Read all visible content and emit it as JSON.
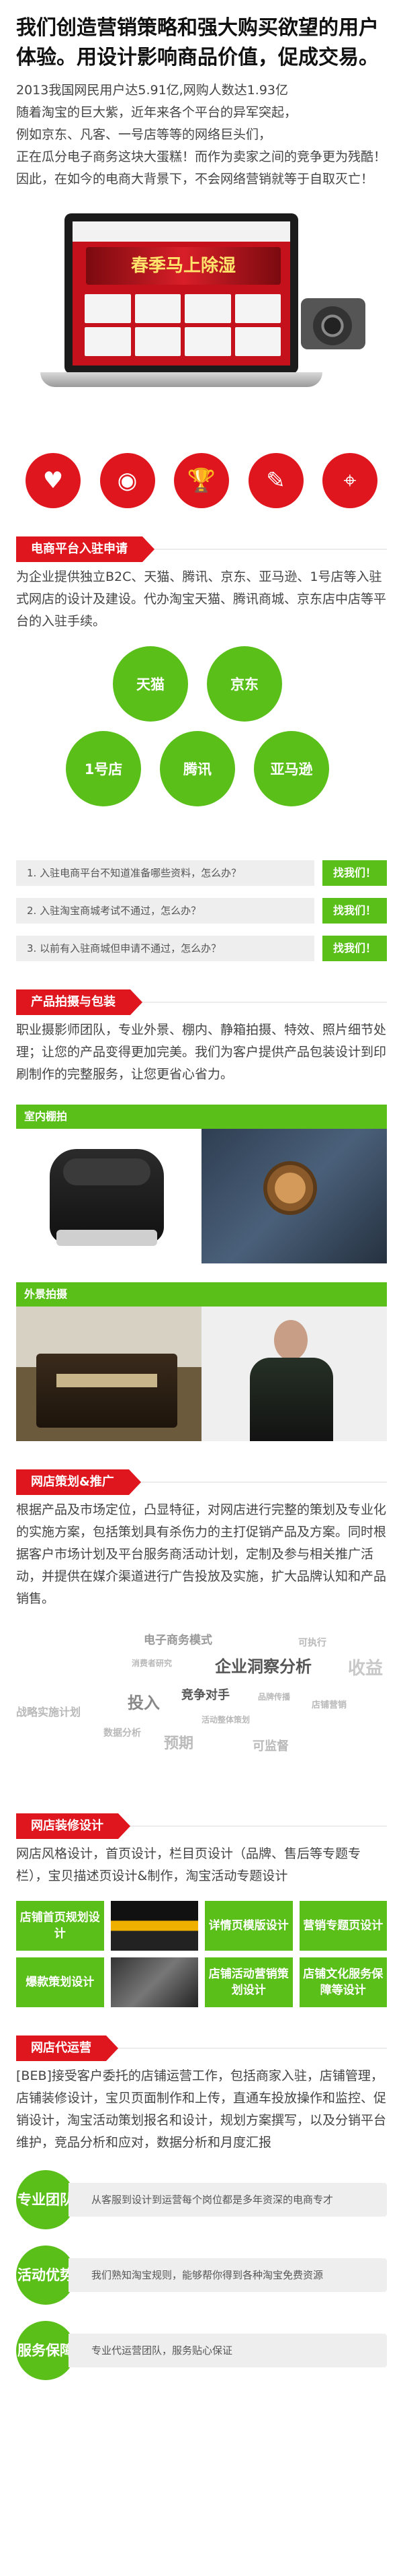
{
  "headline": "我们创造营销策略和强大购买欲望的用户体验。用设计影响商品价值，促成交易。",
  "intro": [
    "2013我国网民用户达5.91亿,网购人数达1.93亿",
    "随着淘宝的巨大紫，近年来各个平台的异军突起，",
    "例如京东、凡客、一号店等等的网络巨头们，",
    "正在瓜分电子商务这块大蛋糕！而作为卖家之间的竞争更为残酷！",
    "因此，在如今的电商大背景下，不会网络营销就等于自取灭亡！"
  ],
  "hero": {
    "banner_text": "春季马上除湿",
    "icons": [
      "laptop-icon",
      "camera-icon"
    ]
  },
  "icon_row": [
    {
      "name": "heart-icon",
      "glyph": "♥"
    },
    {
      "name": "camera-icon",
      "glyph": "◉"
    },
    {
      "name": "trophy-icon",
      "glyph": "🏆"
    },
    {
      "name": "pencil-icon",
      "glyph": "✎"
    },
    {
      "name": "pin-icon",
      "glyph": "⌖"
    }
  ],
  "sections": {
    "platform": {
      "title": "电商平台入驻申请",
      "text": "为企业提供独立B2C、天猫、腾讯、京东、亚马逊、1号店等入驻式网店的设计及建设。代办淘宝天猫、腾讯商城、京东店中店等平台的入驻手续。",
      "bubbles": [
        "天猫",
        "京东",
        "1号店",
        "腾讯",
        "亚马逊"
      ],
      "questions": [
        {
          "q": "1. 入驻电商平台不知道准备哪些资料，怎么办？",
          "btn": "找我们！"
        },
        {
          "q": "2. 入驻淘宝商城考试不通过，怎么办？",
          "btn": "找我们！"
        },
        {
          "q": "3. 以前有入驻商城但申请不通过，怎么办？",
          "btn": "找我们！"
        }
      ]
    },
    "photo": {
      "title": "产品拍摄与包装",
      "text": "职业摄影师团队，专业外景、棚内、静箱拍摄、特效、照片细节处理；让您的产品变得更加完美。我们为客户提供产品包装设计到印刷制作的完整服务，让您更省心省力。",
      "indoor_label": "室内棚拍",
      "outdoor_label": "外景拍摄"
    },
    "planning": {
      "title": "网店策划&推广",
      "text": "根据产品及市场定位，凸显特征，对网店进行完整的策划及专业化的实施方案，包括策划具有杀伤力的主打促销产品及方案。同时根据客户市场计划及平台服务商活动计划，定制及参与相关推广活动，并提供在媒介渠道进行广告投放及实施，扩大品牌认知和产品销售。",
      "cloud": [
        "电子商务模式",
        "可执行",
        "消费者研究",
        "企业洞察分析",
        "收益",
        "投入",
        "竞争对手",
        "品牌传播",
        "战略实施计划",
        "活动整体策划",
        "数据分析",
        "预期",
        "可监督",
        "店铺营销"
      ]
    },
    "decoration": {
      "title": "网店装修设计",
      "text": "网店风格设计，首页设计，栏目页设计（品牌、售后等专题专栏），宝贝描述页设计&制作，淘宝活动专题设计",
      "grid": [
        {
          "kind": "green",
          "label": "店铺首页规划设计"
        },
        {
          "kind": "thumb",
          "label": ""
        },
        {
          "kind": "green",
          "label": "详情页模版设计"
        },
        {
          "kind": "green",
          "label": "营销专题页设计"
        },
        {
          "kind": "green",
          "label": "爆款策划设计"
        },
        {
          "kind": "thumb",
          "label": ""
        },
        {
          "kind": "green",
          "label": "店铺活动营销策划设计"
        },
        {
          "kind": "green",
          "label": "店铺文化服务保障等设计"
        }
      ]
    },
    "operation": {
      "title": "网店代运营",
      "text": "[BEB]接受客户委托的店铺运营工作，包括商家入驻，店铺管理，店铺装修设计，宝贝页面制作和上传，直通车投放操作和监控、促销设计，淘宝活动策划报名和设计，规划方案撰写，以及分销平台维护，竞品分析和应对，数据分析和月度汇报",
      "services": [
        {
          "badge": "专业团队",
          "desc": "从客服到设计到运营每个岗位都是多年资深的电商专才"
        },
        {
          "badge": "活动优势",
          "desc": "我们熟知淘宝规则，能够帮你得到各种淘宝免费资源"
        },
        {
          "badge": "服务保障",
          "desc": "专业代运营团队，服务贴心保证"
        }
      ]
    }
  },
  "colors": {
    "accent_red": "#e0161e",
    "accent_green": "#5bbf1a"
  }
}
